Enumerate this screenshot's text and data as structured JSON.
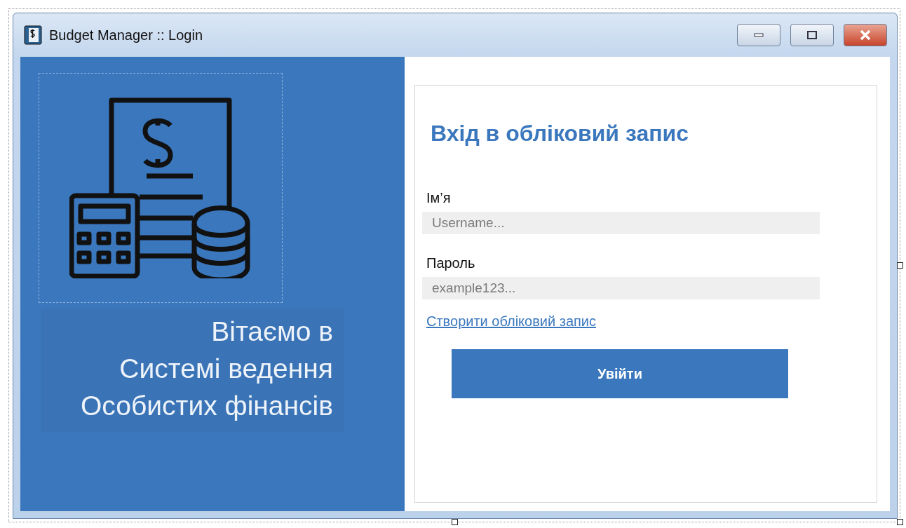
{
  "window": {
    "title": "Budget Manager :: Login"
  },
  "welcome": {
    "lines": [
      "Вітаємо в",
      "Системі ведення",
      "Особистих фінансів"
    ]
  },
  "login": {
    "heading": "Вхід в обліковий запис",
    "fields": [
      {
        "label": "Ім’я",
        "placeholder": "Username..."
      },
      {
        "label": "Пароль",
        "placeholder": "example123..."
      }
    ],
    "link": "Створити обліковий запис",
    "button": "Увійти"
  }
}
